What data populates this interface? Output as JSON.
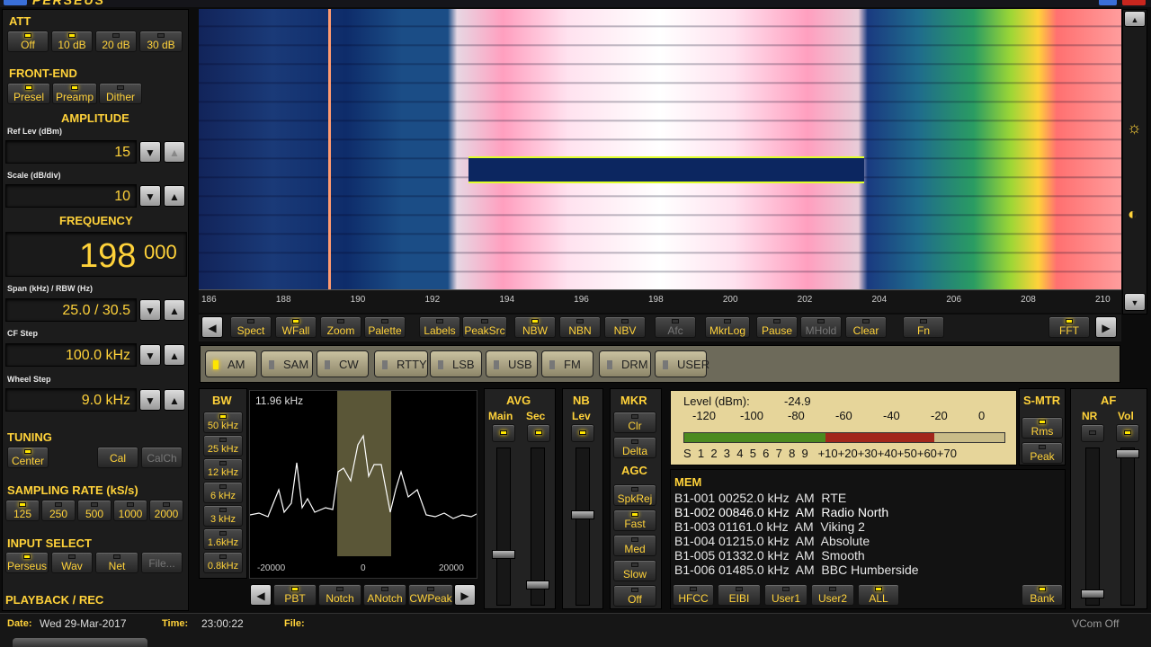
{
  "app": {
    "title": "PERSEUS"
  },
  "att": {
    "title": "ATT",
    "buttons": [
      "Off",
      "10 dB",
      "20 dB",
      "30 dB"
    ]
  },
  "frontend": {
    "title": "FRONT-END",
    "buttons": [
      "Presel",
      "Preamp",
      "Dither"
    ]
  },
  "amplitude": {
    "title": "AMPLITUDE",
    "ref_label": "Ref Lev (dBm)",
    "ref_value": "15",
    "scale_label": "Scale (dB/div)",
    "scale_value": "10"
  },
  "frequency": {
    "title": "FREQUENCY",
    "main": "198",
    "sub": "000",
    "span_label": "Span (kHz) / RBW (Hz)",
    "span_value": "25.0 / 30.5",
    "cf_label": "CF Step",
    "cf_value": "100.0 kHz",
    "wheel_label": "Wheel Step",
    "wheel_value": "9.0 kHz"
  },
  "tuning": {
    "title": "TUNING",
    "buttons": [
      "Center",
      "Cal",
      "CalCh"
    ]
  },
  "sampling": {
    "title": "SAMPLING RATE (kS/s)",
    "buttons": [
      "125",
      "250",
      "500",
      "1000",
      "2000"
    ]
  },
  "input": {
    "title": "INPUT SELECT",
    "buttons": [
      "Perseus",
      "Wav",
      "Net",
      "File..."
    ]
  },
  "playback": {
    "title": "PLAYBACK / REC"
  },
  "status": {
    "date_label": "Date:",
    "date": "Wed 29-Mar-2017",
    "time_label": "Time:",
    "time": "23:00:22",
    "file_label": "File:",
    "vcom": "VCom Off"
  },
  "spectrum": {
    "ticks": [
      "186",
      "188",
      "190",
      "192",
      "194",
      "196",
      "198",
      "200",
      "202",
      "204",
      "206",
      "208",
      "210"
    ]
  },
  "toolbar": {
    "buttons": [
      "Spect",
      "WFall",
      "Zoom",
      "Palette",
      "Labels",
      "PeakSrc",
      "NBW",
      "NBN",
      "NBV",
      "Afc",
      "MkrLog",
      "Pause",
      "MHold",
      "Clear",
      "Fn",
      "FFT"
    ]
  },
  "modes": {
    "buttons": [
      "AM",
      "SAM",
      "CW",
      "RTTY",
      "LSB",
      "USB",
      "FM",
      "DRM",
      "USER"
    ]
  },
  "bw": {
    "title": "BW",
    "buttons": [
      "50 kHz",
      "25 kHz",
      "12 kHz",
      "6 kHz",
      "3 kHz",
      "1.6kHz",
      "0.8kHz"
    ],
    "readout": "11.96 kHz",
    "axis": [
      "-20000",
      "0",
      "20000"
    ],
    "bottom_buttons": [
      "PBT",
      "Notch",
      "ANotch",
      "CWPeak"
    ]
  },
  "avg": {
    "title": "AVG",
    "main": "Main",
    "sec": "Sec"
  },
  "nb": {
    "title": "NB",
    "lev": "Lev"
  },
  "mkr": {
    "title": "MKR",
    "buttons": [
      "Clr",
      "Delta"
    ]
  },
  "agc": {
    "title": "AGC",
    "buttons": [
      "SpkRej",
      "Fast",
      "Med",
      "Slow",
      "Off"
    ]
  },
  "meter": {
    "level_label": "Level (dBm):",
    "level_value": "-24.9",
    "top_scale": [
      "-120",
      "-100",
      "-80",
      "-60",
      "-40",
      "-20",
      "0"
    ],
    "bottom_scale": "S  1  2  3  4  5  6  7  8  9   +10+20+30+40+50+60+70",
    "level_fraction": 0.78
  },
  "smtr": {
    "title": "S-MTR",
    "buttons": [
      "Rms",
      "Peak"
    ]
  },
  "af": {
    "title": "AF",
    "nr": "NR",
    "vol": "Vol"
  },
  "mem": {
    "title": "MEM",
    "rows": [
      "B1-001 00252.0 kHz  AM  RTE",
      "B1-002 00846.0 kHz  AM  Radio North",
      "B1-003 01161.0 kHz  AM  Viking 2",
      "B1-004 01215.0 kHz  AM  Absolute",
      "B1-005 01332.0 kHz  AM  Smooth",
      "B1-006 01485.0 kHz  AM  BBC Humberside"
    ],
    "buttons": [
      "HFCC",
      "EIBI",
      "User1",
      "User2",
      "ALL",
      "Bank"
    ]
  }
}
